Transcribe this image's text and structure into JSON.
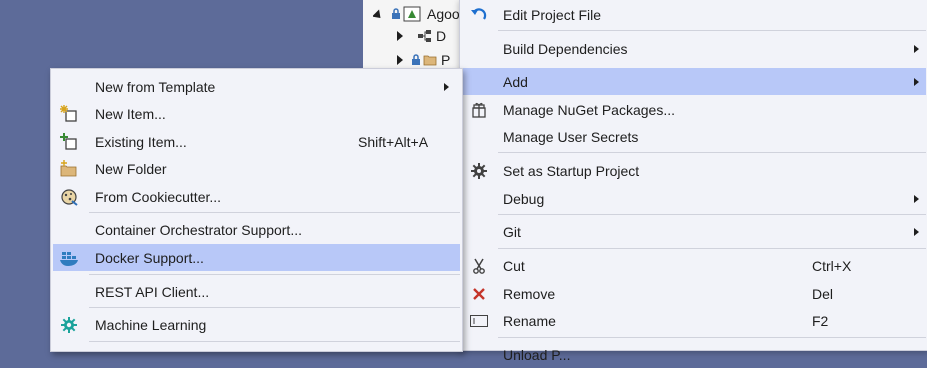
{
  "tree": {
    "project_label": "Agoo",
    "child1_label": "D",
    "child2_label": "P"
  },
  "context_menu": {
    "edit_project_file": "Edit Project File",
    "build_dependencies": "Build Dependencies",
    "add": "Add",
    "manage_nuget": "Manage NuGet Packages...",
    "manage_user_secrets": "Manage User Secrets",
    "set_startup": "Set as Startup Project",
    "debug": "Debug",
    "git": "Git",
    "cut": "Cut",
    "cut_shortcut": "Ctrl+X",
    "remove": "Remove",
    "remove_shortcut": "Del",
    "rename": "Rename",
    "rename_shortcut": "F2",
    "partial_next": "Unload P..."
  },
  "add_submenu": {
    "new_from_template": "New from Template",
    "new_item": "New Item...",
    "existing_item": "Existing Item...",
    "existing_item_shortcut": "Shift+Alt+A",
    "new_folder": "New Folder",
    "from_cookiecutter": "From Cookiecutter...",
    "container_orchestrator": "Container Orchestrator Support...",
    "docker_support": "Docker Support...",
    "rest_api_client": "REST API Client...",
    "machine_learning": "Machine Learning"
  },
  "colors": {
    "background": "#5d6b99",
    "menu_background": "#f2f3f9",
    "highlight": "#b8c8f8",
    "separator": "#d0d2dc"
  }
}
